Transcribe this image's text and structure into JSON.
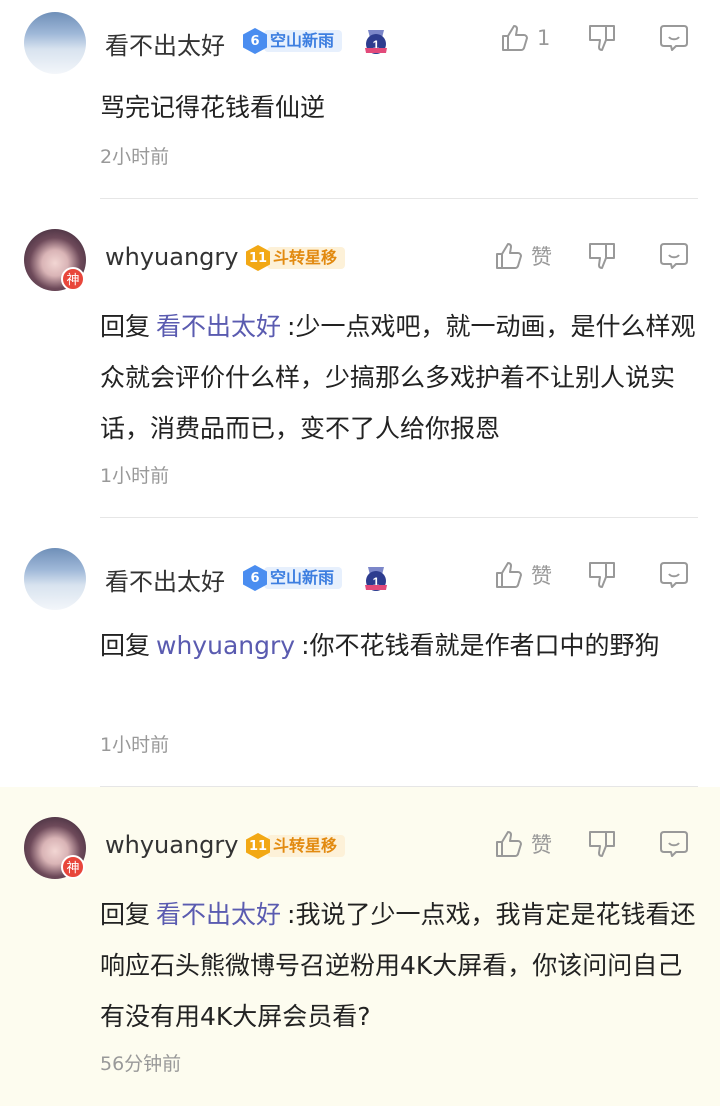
{
  "comments": [
    {
      "username": "看不出太好",
      "level": "6",
      "level_title": "空山新雨",
      "like_label": "1",
      "text": "骂完记得花钱看仙逆",
      "reply_prefix": "",
      "reply_to": "",
      "time": "2小时前"
    },
    {
      "username": "whyuangry",
      "level": "11",
      "level_title": "斗转星移",
      "like_label": "赞",
      "reply_prefix": "回复",
      "reply_to": "看不出太好",
      "text": ":少一点戏吧，就一动画，是什么样观众就会评价什么样，少搞那么多戏护着不让别人说实话，消费品而已，变不了人给你报恩",
      "time": "1小时前",
      "avatar_badge": "神"
    },
    {
      "username": "看不出太好",
      "level": "6",
      "level_title": "空山新雨",
      "like_label": "赞",
      "reply_prefix": "回复",
      "reply_to": "whyuangry",
      "text": ":你不花钱看就是作者口中的野狗",
      "time": "1小时前"
    },
    {
      "username": "whyuangry",
      "level": "11",
      "level_title": "斗转星移",
      "like_label": "赞",
      "reply_prefix": "回复",
      "reply_to": "看不出太好",
      "text": ":我说了少一点戏，我肯定是花钱看还响应石头熊微博号召逆粉用4K大屏看，你该问问自己有没有用4K大屏会员看?",
      "time": "56分钟前",
      "avatar_badge": "神"
    }
  ],
  "icons": {
    "like": "thumbs-up-icon",
    "dislike": "thumbs-down-icon",
    "reply": "comment-icon",
    "medal": "medal-icon"
  },
  "colors": {
    "reply_name": "#5a5bb0",
    "highlight_bg": "#fdfcef",
    "level_blue": "#4a8df0",
    "level_gold": "#f2a815"
  }
}
